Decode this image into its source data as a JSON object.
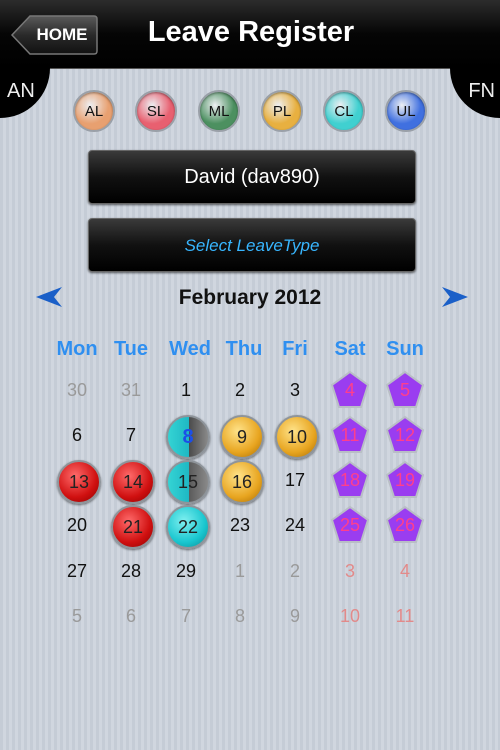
{
  "header": {
    "title": "Leave Register",
    "home_label": "HOME"
  },
  "corners": {
    "left_label": "AN",
    "right_label": "FN"
  },
  "leave_types": [
    {
      "code": "AL",
      "color": "#e8a070"
    },
    {
      "code": "SL",
      "color": "#e86070"
    },
    {
      "code": "ML",
      "color": "#4c9060"
    },
    {
      "code": "PL",
      "color": "#e8b040"
    },
    {
      "code": "CL",
      "color": "#40d0d0"
    },
    {
      "code": "UL",
      "color": "#4070e0"
    }
  ],
  "employee": {
    "display": "David  (dav890)"
  },
  "leave_select": {
    "placeholder": "Select LeaveType"
  },
  "calendar": {
    "month": "February 2012",
    "weekdays": [
      "Mon",
      "Tue",
      "Wed",
      "Thu",
      "Fri",
      "Sat",
      "Sun"
    ],
    "weeks": [
      [
        "30",
        "31",
        "1",
        "2",
        "3",
        "4",
        "5"
      ],
      [
        "6",
        "7",
        "8",
        "9",
        "10",
        "11",
        "12"
      ],
      [
        "13",
        "14",
        "15",
        "16",
        "17",
        "18",
        "19"
      ],
      [
        "20",
        "21",
        "22",
        "23",
        "24",
        "25",
        "26"
      ],
      [
        "27",
        "28",
        "29",
        "1",
        "2",
        "3",
        "4"
      ],
      [
        "5",
        "6",
        "7",
        "8",
        "9",
        "10",
        "11"
      ]
    ]
  },
  "colors": {
    "accent": "#2f8ff0",
    "weekend_marker": "#9a3df0",
    "weekend_text": "#ff3e8c"
  }
}
